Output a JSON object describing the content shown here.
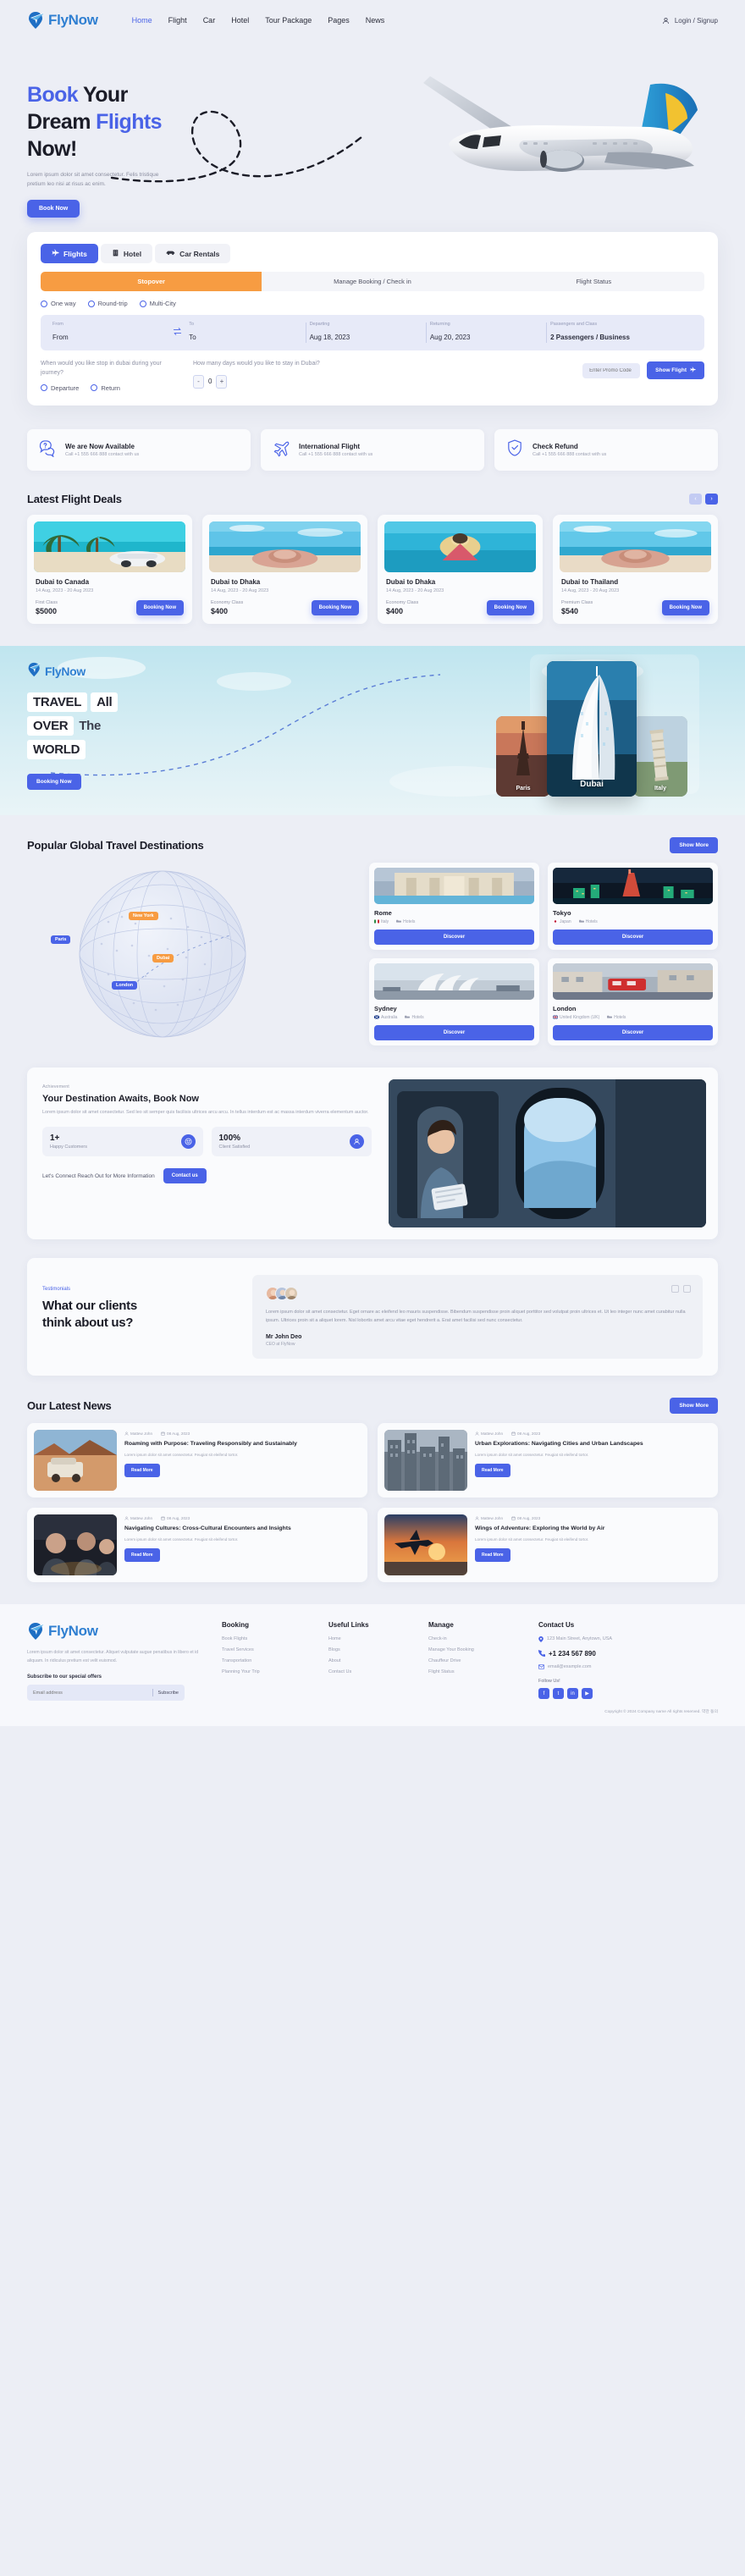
{
  "brand": {
    "name": "FlyNow"
  },
  "header": {
    "nav": [
      {
        "label": "Home",
        "active": true
      },
      {
        "label": "Flight",
        "active": false
      },
      {
        "label": "Car",
        "active": false
      },
      {
        "label": "Hotel",
        "active": false
      },
      {
        "label": "Tour Package",
        "active": false
      },
      {
        "label": "Pages",
        "active": false
      },
      {
        "label": "News",
        "active": false
      }
    ],
    "account": "Login / Signup",
    "account_icon": "user-icon"
  },
  "hero": {
    "title_1": "Book",
    "title_2": " Your",
    "title_3": "Dream ",
    "title_4": "Flights",
    "title_5": "Now!",
    "desc": "Lorem ipsum dolor sit amet consectetur. Felis tristique pretium leo nisi at risus ac enim.",
    "cta": "Book Now"
  },
  "booking": {
    "type_tabs": [
      {
        "label": "Flights",
        "icon": "plane-icon",
        "active": true
      },
      {
        "label": "Hotel",
        "icon": "building-icon",
        "active": false
      },
      {
        "label": "Car Rentals",
        "icon": "car-icon",
        "active": false
      }
    ],
    "sub_tabs": [
      {
        "label": "Stopover",
        "active": true
      },
      {
        "label": "Manage Booking / Check in",
        "active": false
      },
      {
        "label": "Flight Status",
        "active": false
      }
    ],
    "trip_options": [
      {
        "label": "One way"
      },
      {
        "label": "Round-trip"
      },
      {
        "label": "Multi-City"
      }
    ],
    "fields": {
      "from_label": "From",
      "from_value": "From",
      "to_label": "To",
      "to_value": "To",
      "departing_label": "Departing",
      "departing_value": "Aug 18, 2023",
      "returning_label": "Returning",
      "returning_value": "Aug 20, 2023",
      "passengers_label": "Passengers and Class",
      "passengers_value": "2 Passengers / Business",
      "swap_icon": "swap-icon"
    },
    "stopover_question": "When would you like stop in dubai during your journey?",
    "stopover_options": [
      {
        "label": "Departure"
      },
      {
        "label": "Return"
      }
    ],
    "days_question": "How many days would you like to stay in Dubai?",
    "days_value": "0",
    "minus": "-",
    "plus": "+",
    "promo_placeholder": "Enter Promo Code",
    "show_flight": "Show Flight"
  },
  "features": [
    {
      "icon": "question-chat-icon",
      "title": "We are Now Available",
      "subtitle": "Call +1 555 666 888 contact with us"
    },
    {
      "icon": "plane-tilt-icon",
      "title": "International Flight",
      "subtitle": "Call +1 555 666 888 contact with us"
    },
    {
      "icon": "shield-refund-icon",
      "title": "Check Refund",
      "subtitle": "Call +1 555 666 888 contact with us"
    }
  ],
  "deals": {
    "title": "Latest Flight Deals",
    "prev_icon": "chevron-left-icon",
    "next_icon": "chevron-right-icon",
    "items": [
      {
        "title": "Dubai to Canada",
        "dates": "14 Aug, 2023 - 20 Aug 2023",
        "class": "First Class",
        "price": "$5000",
        "cta": "Booking Now",
        "img": "beach-palm-car"
      },
      {
        "title": "Dubai to Dhaka",
        "dates": "14 Aug, 2023 - 20 Aug 2023",
        "class": "Economy Class",
        "price": "$400",
        "cta": "Booking Now",
        "img": "beach-hat"
      },
      {
        "title": "Dubai to Dhaka",
        "dates": "14 Aug, 2023 - 20 Aug 2023",
        "class": "Economy Class",
        "price": "$400",
        "cta": "Booking Now",
        "img": "beach-person"
      },
      {
        "title": "Dubai to Thailand",
        "dates": "14 Aug, 2023 - 20 Aug 2023",
        "class": "Premium Class",
        "price": "$540",
        "cta": "Booking Now",
        "img": "beach-hat2"
      }
    ]
  },
  "travel_banner": {
    "word1": "TRAVEL",
    "word2": "All",
    "word3": "OVER",
    "word4": "The",
    "word5": "WORLD",
    "cta": "Booking Now",
    "cards": [
      {
        "label": "Paris",
        "img": "eiffel-tower"
      },
      {
        "label": "Dubai",
        "img": "burj-al-arab"
      },
      {
        "label": "Italy",
        "img": "pisa-tower"
      }
    ]
  },
  "destinations": {
    "title": "Popular Global Travel Destinations",
    "show_more": "Show More",
    "map_pins": [
      {
        "label": "New York",
        "color": "orange"
      },
      {
        "label": "Paris",
        "color": "blue"
      },
      {
        "label": "Dubai",
        "color": "orange"
      },
      {
        "label": "London",
        "color": "blue"
      }
    ],
    "cards": [
      {
        "title": "Rome",
        "country": "Italy",
        "hotels": "Hotels",
        "cta": "Discover",
        "img": "trevi-fountain"
      },
      {
        "title": "Tokyo",
        "country": "Japan",
        "hotels": "Hotels",
        "cta": "Discover",
        "img": "tokyo-tower"
      },
      {
        "title": "Sydney",
        "country": "Australia",
        "hotels": "Hotels",
        "cta": "Discover",
        "img": "sydney-opera"
      },
      {
        "title": "London",
        "country": "United Kingdom (UK)",
        "hotels": "Hotels",
        "cta": "Discover",
        "img": "london-street"
      }
    ]
  },
  "achievement": {
    "kicker": "Achievement",
    "title": "Your Destination Awaits, Book Now",
    "desc": "Lorem ipsum dolor sit amet consectetur. Sed leo sit semper quis facilisis ultrices arcu arcu. In tellus interdum est ac massa interdum viverra elementum auctor.",
    "stats": [
      {
        "number": "1+",
        "label": "Happy Customers",
        "icon": "smile-icon"
      },
      {
        "number": "100%",
        "label": "Client Satisfied",
        "icon": "user-check-icon"
      }
    ],
    "cta_text": "Let's Connect Reach Out for More Information",
    "cta": "Contact us",
    "img": "woman-airplane-window"
  },
  "testimonial": {
    "kicker": "Testimonials",
    "title_1": "What our clients",
    "title_2": "think about us?",
    "text": "Lorem ipsum dolor sit amet consectetur. Eget ornare ac eleifend leo mauris suspendisse. Bibendum suspendisse proin aliquet porttitor sed volutpat proin ultrices et. Ut leo integer nunc amet curabitur nulla ipsum. Ultrices proin sit a aliquet lorem. Nisl lobortis amet arcu vitae eget hendrerit a. Erat amet facilisi sed nunc consectetur.",
    "name": "Mr John Deo",
    "role": "CEO at FlyNow",
    "prev_icon": "chevron-left-icon",
    "next_icon": "chevron-right-icon"
  },
  "news": {
    "title": "Our Latest News",
    "show_more": "Show More",
    "items": [
      {
        "author": "Mattew John",
        "date": "08 Aug, 2023",
        "title": "Roaming with Purpose: Traveling Responsibly and Sustainably",
        "desc": "Lorem ipsum dolor sit amet consectetur. Feugiat sit eleifend tortor.",
        "cta": "Read More",
        "img": "desert-van"
      },
      {
        "author": "Mattew John",
        "date": "08 Aug, 2023",
        "title": "Urban Explorations: Navigating Cities and Urban Landscapes",
        "desc": "Lorem ipsum dolor sit amet consectetur. Feugiat sit eleifend tortor.",
        "cta": "Read More",
        "img": "city-buildings"
      },
      {
        "author": "Mattew John",
        "date": "08 Aug, 2023",
        "title": "Navigating Cultures: Cross-Cultural Encounters and Insights",
        "desc": "Lorem ipsum dolor sit amet consectetur. Feugiat sit eleifend tortor.",
        "cta": "Read More",
        "img": "friends-night"
      },
      {
        "author": "Mattew John",
        "date": "08 Aug, 2023",
        "title": "Wings of Adventure: Exploring the World by Air",
        "desc": "Lorem ipsum dolor sit amet consectetur. Feugiat sit eleifend tortor.",
        "cta": "Read More",
        "img": "plane-sunset"
      }
    ]
  },
  "footer": {
    "desc": "Lorem ipsum dolor sit amet consectetur. Aliquet vulputate augue penatibus in libero et id aliquam. In ridiculus pretium est velit euismod.",
    "subscribe_title": "Subscribe to our special offers",
    "email_placeholder": "Email address",
    "subscribe_btn": "Subscribe",
    "columns": [
      {
        "heading": "Booking",
        "links": [
          "Book Flights",
          "Travel Services",
          "Transportation",
          "Planning Your Trip"
        ]
      },
      {
        "heading": "Useful Links",
        "links": [
          "Home",
          "Blogs",
          "About",
          "Contact Us"
        ]
      },
      {
        "heading": "Manage",
        "links": [
          "Check-in",
          "Manage Your Booking",
          "Chauffeur Drive",
          "Flight Status"
        ]
      }
    ],
    "contact": {
      "heading": "Contact Us",
      "address": "123 Main Street, Anytown, USA",
      "phone": "+1 234 567 890",
      "email": "email@example.com",
      "follow": "Follow Us!",
      "socials": [
        "facebook-icon",
        "twitter-icon",
        "linkedin-icon",
        "youtube-icon"
      ]
    },
    "copyright": "Copyright © 2024 Company name All rights reserved. 약관 동의"
  },
  "colors": {
    "accent": "#4a63e7",
    "orange": "#f79c42",
    "logo_blue": "#2f7fd1",
    "page_bg": "#eceef5"
  }
}
